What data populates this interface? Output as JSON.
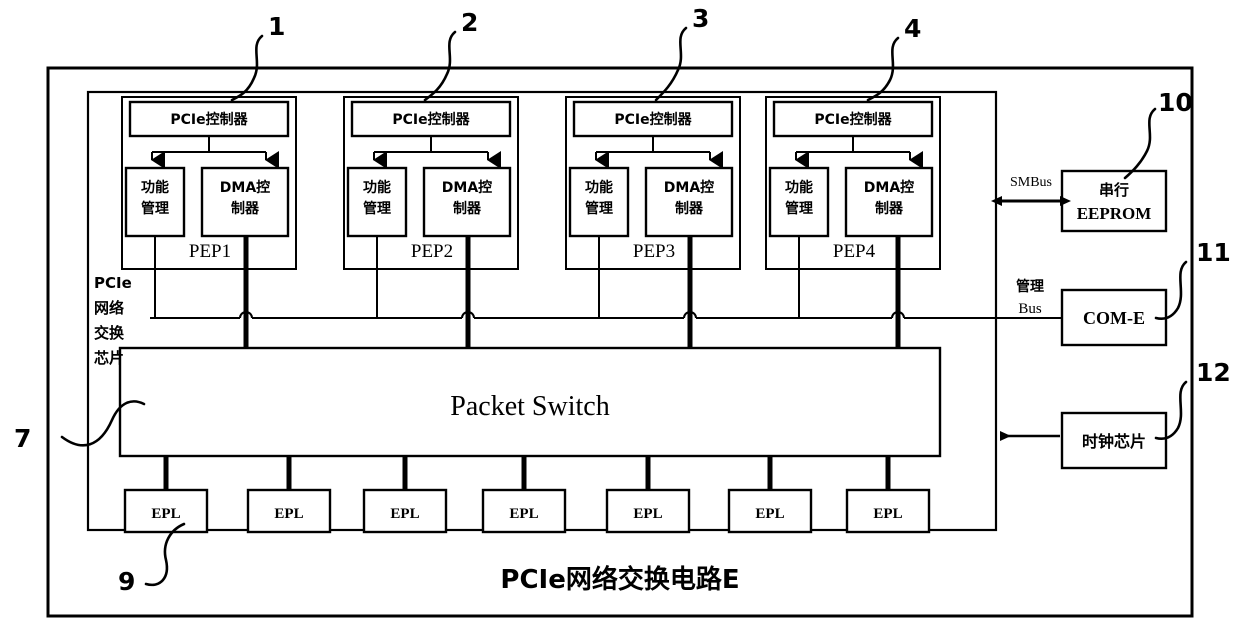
{
  "diagram": {
    "title": "PCIe网络交换电路E",
    "outer_frame_label": "PCIe网络交换电路E",
    "switch_chip_label": {
      "lines": [
        "PCIe",
        "网络",
        "交换",
        "芯片"
      ],
      "full": "PCIe网络交换芯片"
    },
    "packet_switch": "Packet Switch"
  },
  "pep_blocks": [
    {
      "callout": "1",
      "name": "PEP1",
      "controller": "PCIe控制器",
      "function_mgmt": [
        "功能",
        "管理"
      ],
      "dma": [
        "DMA控",
        "制器"
      ]
    },
    {
      "callout": "2",
      "name": "PEP2",
      "controller": "PCIe控制器",
      "function_mgmt": [
        "功能",
        "管理"
      ],
      "dma": [
        "DMA控",
        "制器"
      ]
    },
    {
      "callout": "3",
      "name": "PEP3",
      "controller": "PCIe控制器",
      "function_mgmt": [
        "功能",
        "管理"
      ],
      "dma": [
        "DMA控",
        "制器"
      ]
    },
    {
      "callout": "4",
      "name": "PEP4",
      "controller": "PCIe控制器",
      "function_mgmt": [
        "功能",
        "管理"
      ],
      "dma": [
        "DMA控",
        "制器"
      ]
    }
  ],
  "peripherals": [
    {
      "callout": "10",
      "lines": [
        "串行",
        "EEPROM"
      ],
      "bus_label": [
        "SMBus"
      ],
      "bus_type": "bidirectional"
    },
    {
      "callout": "11",
      "lines": [
        "COM-E"
      ],
      "bus_label": [
        "管理",
        "Bus"
      ],
      "bus_type": "line"
    },
    {
      "callout": "12",
      "lines": [
        "时钟芯片"
      ],
      "bus_label": [],
      "bus_type": "arrow-left"
    }
  ],
  "epl_blocks": [
    {
      "label": "EPL"
    },
    {
      "label": "EPL"
    },
    {
      "label": "EPL"
    },
    {
      "label": "EPL"
    },
    {
      "label": "EPL"
    },
    {
      "label": "EPL"
    },
    {
      "label": "EPL"
    }
  ],
  "epl_callout": "9",
  "packet_switch_callout": "7",
  "colors": {
    "ink": "#000000",
    "paper": "#ffffff"
  }
}
